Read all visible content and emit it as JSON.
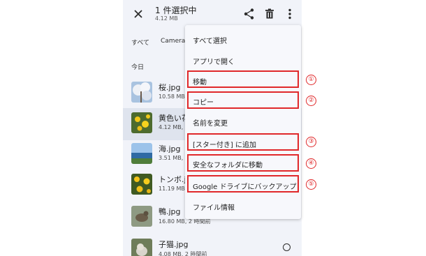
{
  "topbar": {
    "title": "1 件選択中",
    "size": "4.12 MB",
    "close_icon": "close-icon",
    "share_icon": "share-icon",
    "delete_icon": "trash-icon",
    "more_icon": "more-vert-icon"
  },
  "chips": [
    "すべて",
    "Camera"
  ],
  "section_label": "今日",
  "files": [
    {
      "name": "桜.jpg",
      "meta": "10.58 MB, 2",
      "selected": false
    },
    {
      "name": "黄色い花",
      "meta": "4.12 MB, 2",
      "selected": true
    },
    {
      "name": "海.jpg",
      "meta": "3.51 MB, 2",
      "selected": false
    },
    {
      "name": "トンボ.jp",
      "meta": "11.19 MB, 2",
      "selected": false
    },
    {
      "name": "鴨.jpg",
      "meta": "16.80 MB, 2 時間前",
      "selected": false
    },
    {
      "name": "子猫.jpg",
      "meta": "4.08 MB, 2 時間前",
      "selected": false
    }
  ],
  "menu": {
    "items": [
      {
        "label": "すべて選択"
      },
      {
        "label": "アプリで開く"
      },
      {
        "label": "移動",
        "marker": "①"
      },
      {
        "label": "コピー",
        "marker": "②"
      },
      {
        "label": "名前を変更"
      },
      {
        "label": "[スター付き] に追加",
        "marker": "③"
      },
      {
        "label": "安全なフォルダに移動",
        "marker": "④"
      },
      {
        "label": "Google ドライブにバックアップ",
        "marker": "⑤"
      },
      {
        "label": "ファイル情報"
      }
    ]
  },
  "colors": {
    "highlight": "#e0282a",
    "background": "#f1f3f9",
    "selected_row": "#dfe4ee"
  }
}
